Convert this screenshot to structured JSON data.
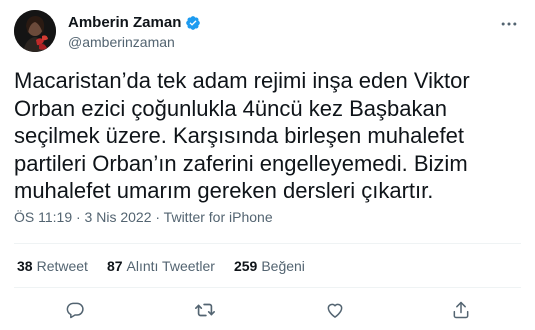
{
  "author": {
    "name": "Amberin Zaman",
    "handle": "@amberinzaman"
  },
  "tweet": {
    "text": "Macaristan’da tek adam rejimi inşa eden Viktor Orban ezici çoğunlukla 4üncü kez Başbakan seçilmek üzere. Karşısında birleşen muhalefet partileri Orban’ın zaferini engelleyemedi. Bizim muhalefet umarım gereken dersleri çıkartır.",
    "timestamp": "ÖS 11:19 · 3 Nis 2022 · Twitter for iPhone"
  },
  "stats": {
    "retweets": {
      "count": "38",
      "label": "Retweet"
    },
    "quotes": {
      "count": "87",
      "label": "Alıntı Tweetler"
    },
    "likes": {
      "count": "259",
      "label": "Beğeni"
    }
  },
  "icons": {
    "verified": "verified-badge-icon",
    "more": "more-options-icon",
    "reply": "reply-icon",
    "retweet": "retweet-icon",
    "like": "heart-icon",
    "share": "share-icon"
  },
  "colors": {
    "verified": "#1d9bf0",
    "secondary_text": "#536471",
    "divider": "#eff3f4"
  }
}
